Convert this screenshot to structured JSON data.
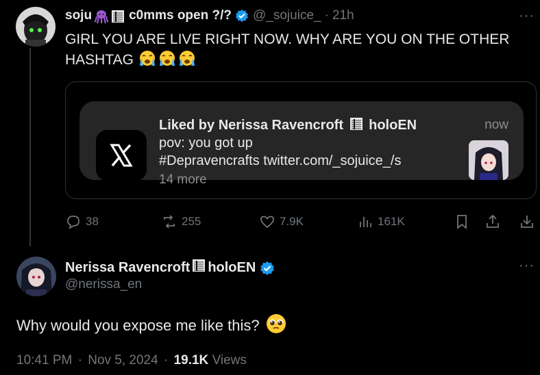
{
  "tweet": {
    "author_name": "soju",
    "author_suffix": "c0mms open ?/?",
    "handle": "@_sojuice_",
    "separator": "·",
    "time": "21h",
    "more": "···",
    "text": "GIRL YOU ARE LIVE RIGHT NOW. WHY ARE YOU ON THE OTHER HASHTAG",
    "embed": {
      "title": "Liked by Nerissa Ravencroft",
      "title_suffix": "holoEN",
      "time": "now",
      "line1": "pov: you got up",
      "line2": "#Depravencrafts twitter.com/_sojuice_/s",
      "more": "14 more",
      "app_icon": "x-logo-icon"
    },
    "actions": {
      "replies": "38",
      "reposts": "255",
      "likes": "7.9K",
      "views": "161K"
    }
  },
  "main_tweet": {
    "author_name": "Nerissa Ravencroft",
    "author_suffix": "holoEN",
    "handle": "@nerissa_en",
    "more": "···",
    "text": "Why would you expose me like this?",
    "time": "10:41 PM",
    "dot1": "·",
    "date": "Nov 5, 2024",
    "dot2": "·",
    "views_count": "19.1K",
    "views_label": "Views"
  },
  "colors": {
    "background": "#000000",
    "text": "#e7e9ea",
    "muted": "#71767b",
    "verified": "#1d9bf0",
    "card": "#262626"
  }
}
